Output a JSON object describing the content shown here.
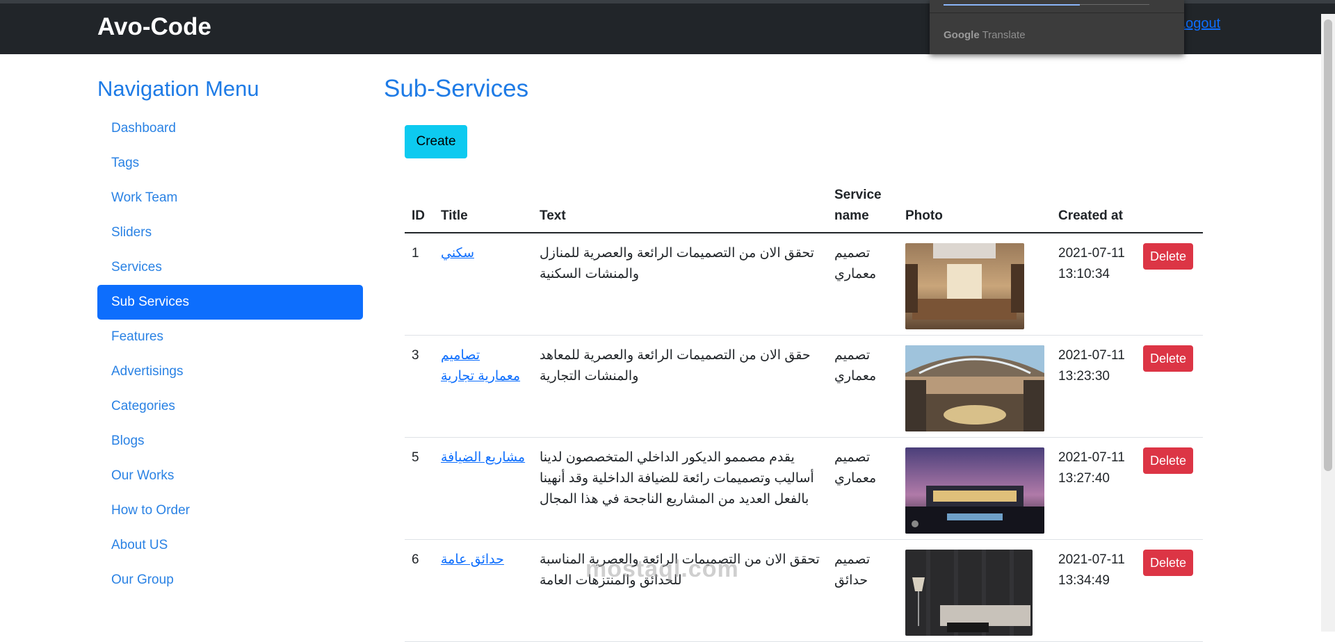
{
  "navbar": {
    "brand": "Avo-Code",
    "logout_label": "Logout"
  },
  "translate_popup": {
    "google": "Google",
    "translate": "Translate"
  },
  "sidebar": {
    "title": "Navigation Menu",
    "items": [
      {
        "label": "Dashboard"
      },
      {
        "label": "Tags"
      },
      {
        "label": "Work Team"
      },
      {
        "label": "Sliders"
      },
      {
        "label": "Services"
      },
      {
        "label": "Sub Services",
        "active": true
      },
      {
        "label": "Features"
      },
      {
        "label": "Advertisings"
      },
      {
        "label": "Categories"
      },
      {
        "label": "Blogs"
      },
      {
        "label": "Our Works"
      },
      {
        "label": "How to Order"
      },
      {
        "label": "About US"
      },
      {
        "label": "Our Group"
      }
    ]
  },
  "main": {
    "title": "Sub-Services",
    "create_label": "Create",
    "table": {
      "headers": {
        "id": "ID",
        "title": "Title",
        "text": "Text",
        "service_name": "Service name",
        "photo": "Photo",
        "created_at": "Created at"
      },
      "delete_label": "Delete",
      "rows": [
        {
          "id": "1",
          "title": "سكني",
          "text": "تحقق الان من التصميمات الرائعة والعصرية للمنازل والمنشات السكنية",
          "service_name": "تصميم معماري",
          "created_at": "2021-07-11 13:10:34",
          "photo": "interior-room"
        },
        {
          "id": "3",
          "title": "تصاميم معمارية تجارية",
          "text": "حقق الان من التصميمات الرائعة والعصرية للمعاهد والمنشات التجارية",
          "service_name": "تصميم معماري",
          "created_at": "2021-07-11 13:23:30",
          "photo": "shopping-mall"
        },
        {
          "id": "5",
          "title": "مشاريع الضيافة",
          "text": "يقدم مصممو الديكور الداخلي المتخصصون لدينا أساليب وتصميمات رائعة للضيافة الداخلية وقد أنهينا بالفعل العديد من المشاريع الناجحة في هذا المجال",
          "service_name": "تصميم معماري",
          "created_at": "2021-07-11 13:27:40",
          "photo": "building-night"
        },
        {
          "id": "6",
          "title": "حدائق عامة",
          "text": "تحقق الان من التصميمات الرائعة والعصرية المناسبة للحدائق والمنتزهات العامة",
          "service_name": "تصميم حدائق",
          "created_at": "2021-07-11 13:34:49",
          "photo": "dark-lounge"
        }
      ]
    }
  },
  "watermark": "mostaql.com",
  "colors": {
    "navbar_bg": "#212529",
    "accent": "#0d6efd",
    "create": "#0dcaf0",
    "danger": "#dc3545"
  }
}
